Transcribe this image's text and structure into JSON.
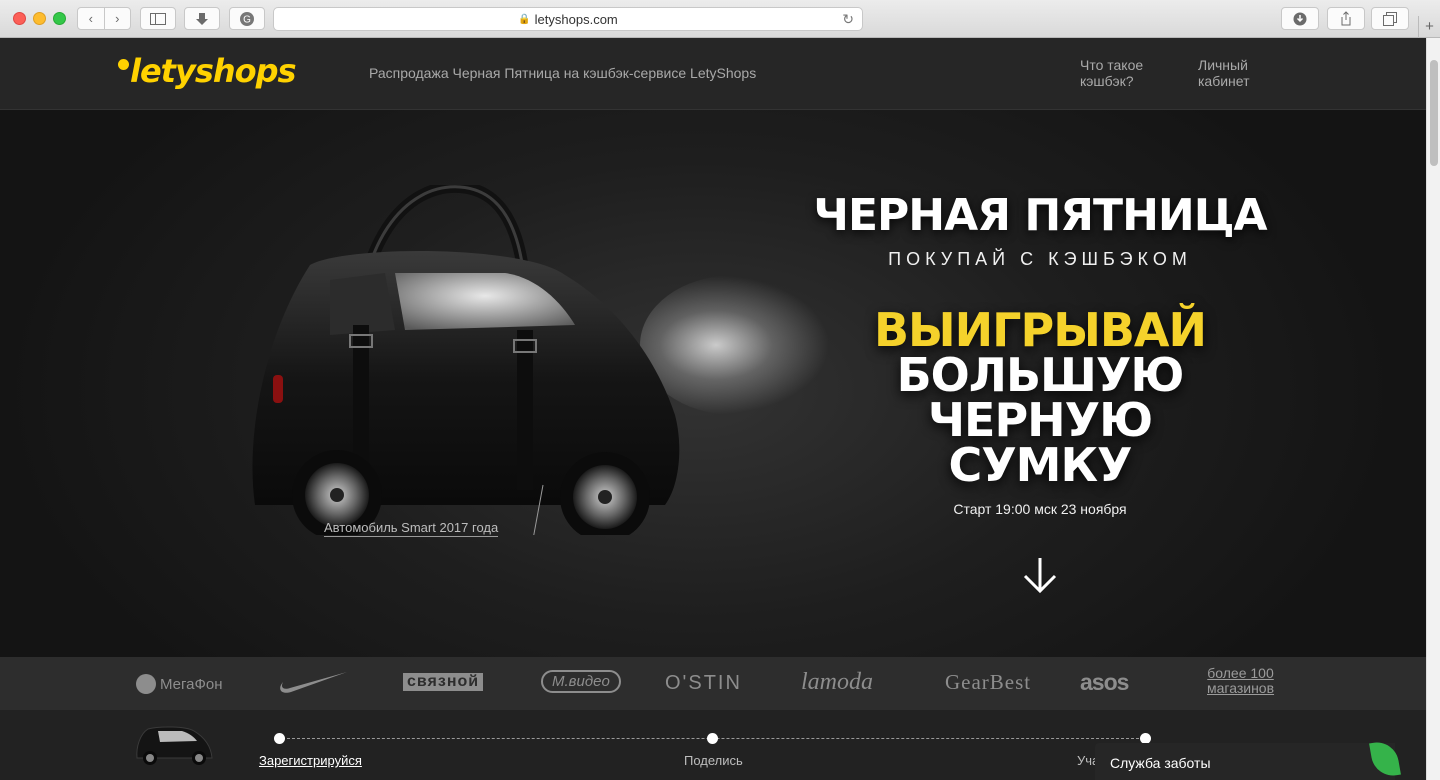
{
  "browser": {
    "url": "letyshops.com",
    "plus_label": "+"
  },
  "header": {
    "logo_text": "letyshops",
    "tagline": "Распродажа Черная Пятница на кэшбэк-сервисе LetyShops",
    "nav": [
      {
        "label": "Что такое кэшбэк?"
      },
      {
        "label": "Личный кабинет"
      }
    ]
  },
  "hero": {
    "title": "ЧЕРНАЯ ПЯТНИЦА",
    "subtitle": "ПОКУПАЙ С КЭШБЭКОМ",
    "headline_yellow": "ВЫИГРЫВАЙ",
    "headline_line2": "БОЛЬШУЮ",
    "headline_line3": "ЧЕРНУЮ",
    "headline_line4": "СУМКУ",
    "start_text": "Старт 19:00 мск 23 ноября",
    "car_caption": "Автомобиль Smart 2017 года"
  },
  "brands": {
    "items": [
      "МегаФон",
      "Nike",
      "связной",
      "М.видео",
      "O'STIN",
      "lamoda",
      "GearBest",
      "asos"
    ],
    "more_line1": "более 100",
    "more_line2": "магазинов"
  },
  "steps": {
    "items": [
      "Зарегистрируйся",
      "Поделись",
      "Уча"
    ]
  },
  "support": {
    "label": "Служба заботы"
  }
}
